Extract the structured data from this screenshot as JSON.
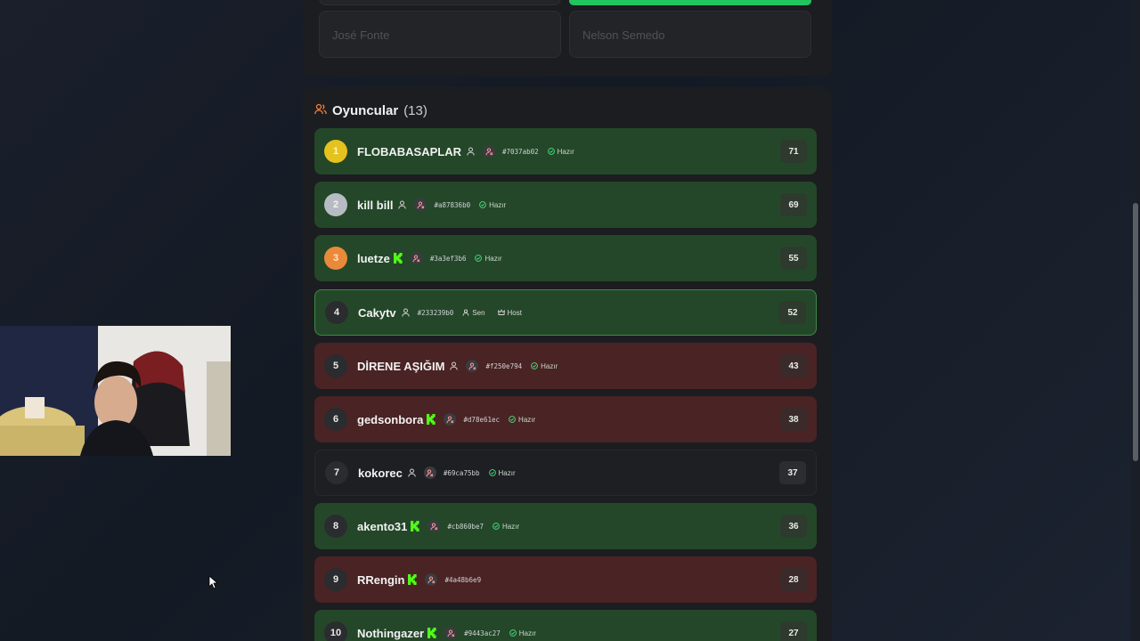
{
  "answers": {
    "left_placeholder": "José Fonte",
    "right_placeholder": "Nelson Semedo",
    "top_right_color": "#22c55e"
  },
  "players_section": {
    "title": "Oyuncular",
    "count": "(13)",
    "icon": "users-icon",
    "accent_color": "#f0803a"
  },
  "players": [
    {
      "rank": "1",
      "name": "FLOBABASAPLAR",
      "badge": "user-icon",
      "id": "#7037ab02",
      "status": "Hazır",
      "score": "71",
      "state": "green",
      "medal": "gold"
    },
    {
      "rank": "2",
      "name": "kill bill",
      "badge": "user-icon",
      "id": "#a87836b0",
      "status": "Hazır",
      "score": "69",
      "state": "green",
      "medal": "silver"
    },
    {
      "rank": "3",
      "name": "luetze",
      "badge": "kick-icon",
      "id": "#3a3ef3b6",
      "status": "Hazır",
      "score": "55",
      "state": "green",
      "medal": "bronze"
    },
    {
      "rank": "4",
      "name": "Cakytv",
      "badge": "user-icon",
      "id": "#233239b0",
      "status": "Sen",
      "extra": "Host",
      "score": "52",
      "state": "self",
      "medal": ""
    },
    {
      "rank": "5",
      "name": "DİRENE AŞIĞIM",
      "badge": "user-icon",
      "id": "#f250e794",
      "status": "Hazır",
      "score": "43",
      "state": "red",
      "medal": ""
    },
    {
      "rank": "6",
      "name": "gedsonbora",
      "badge": "kick-icon",
      "id": "#d78e61ec",
      "status": "Hazır",
      "score": "38",
      "state": "red",
      "medal": ""
    },
    {
      "rank": "7",
      "name": "kokorec",
      "badge": "user-icon",
      "id": "#69ca75bb",
      "status": "Hazır",
      "score": "37",
      "state": "neutral",
      "medal": ""
    },
    {
      "rank": "8",
      "name": "akento31",
      "badge": "kick-icon",
      "id": "#cb860be7",
      "status": "Hazır",
      "score": "36",
      "state": "green",
      "medal": ""
    },
    {
      "rank": "9",
      "name": "RRengin",
      "badge": "kick-icon",
      "id": "#4a48b6e9",
      "status": "",
      "score": "28",
      "state": "red",
      "medal": ""
    },
    {
      "rank": "10",
      "name": "Nothingazer",
      "badge": "kick-icon",
      "id": "#9443ac27",
      "status": "Hazır",
      "score": "27",
      "state": "green",
      "medal": ""
    }
  ],
  "colors": {
    "kick_green": "#53fc18",
    "row_green": "#244729",
    "row_red": "#4a2324",
    "ready_green": "#4ade80"
  }
}
